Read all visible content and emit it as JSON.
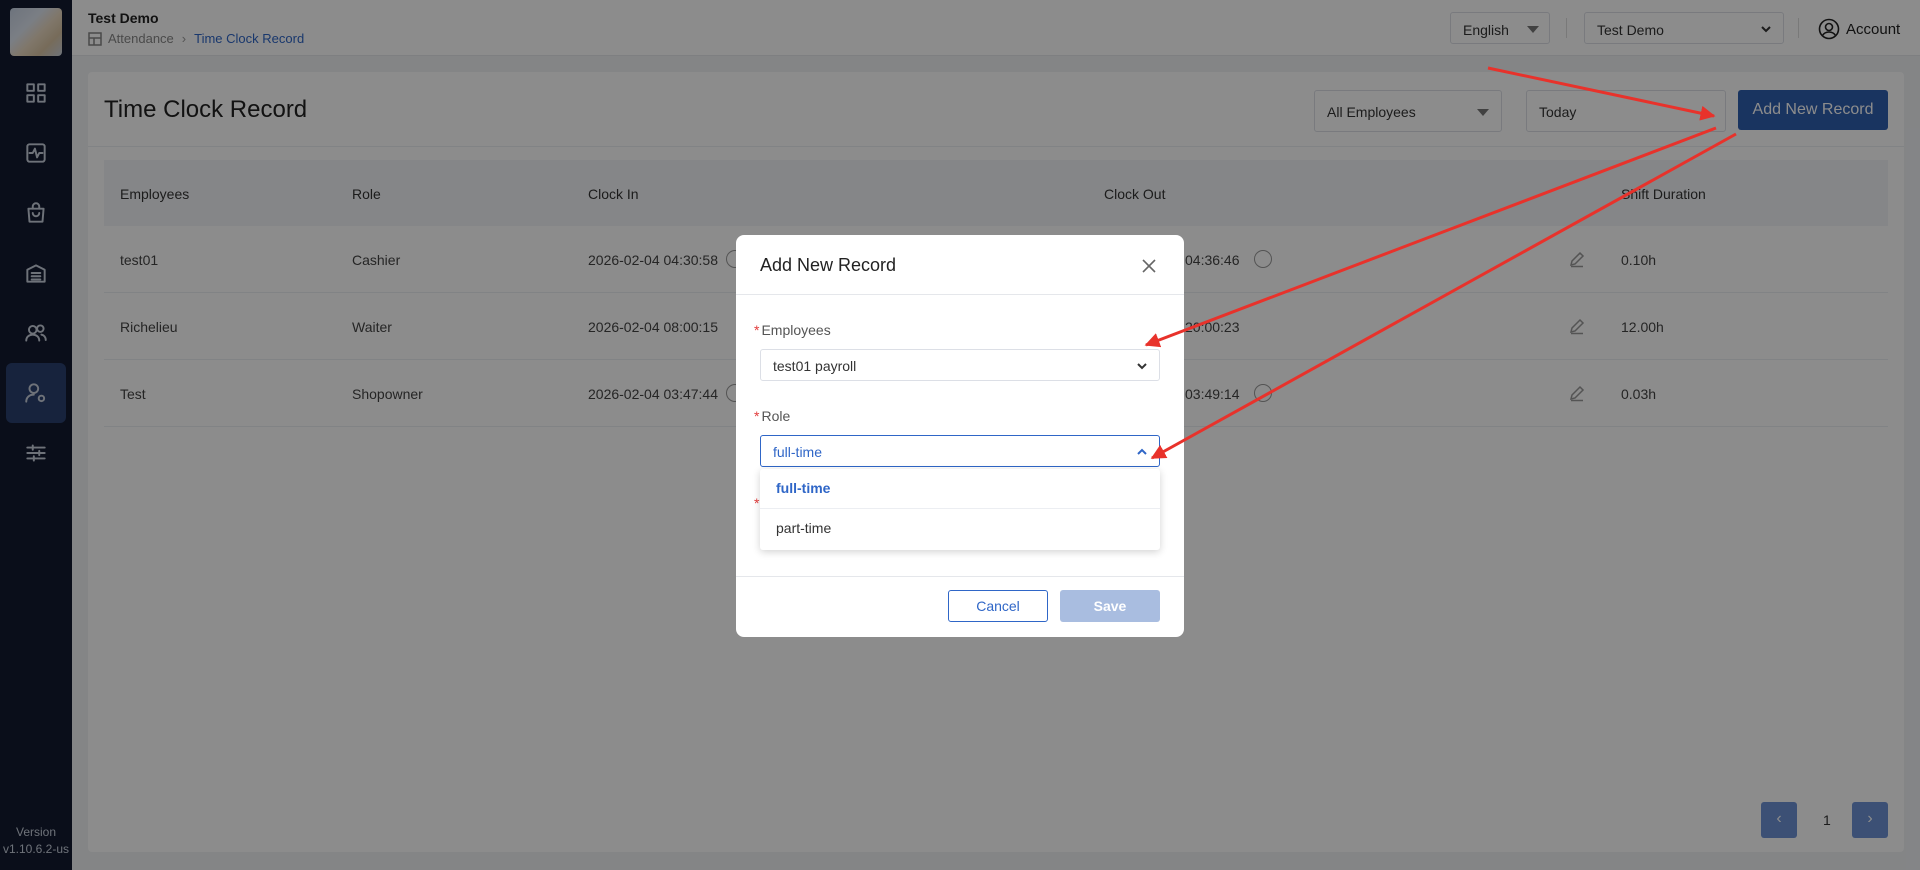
{
  "app": {
    "store_name": "Test Demo",
    "version_label": "Version",
    "version": "v1.10.6.2-us"
  },
  "breadcrumb": {
    "parent": "Attendance",
    "current": "Time Clock Record"
  },
  "header": {
    "language": "English",
    "store": "Test Demo",
    "account": "Account"
  },
  "page": {
    "title": "Time Clock Record",
    "filter_employees": "All Employees",
    "filter_date": "Today",
    "add_button": "Add New Record"
  },
  "table": {
    "columns": [
      "Employees",
      "Role",
      "Clock In",
      "Clock Out",
      "Shift Duration"
    ],
    "rows": [
      {
        "employee": "test01",
        "role": "Cashier",
        "clock_in": "2026-02-04 04:30:58",
        "clock_out": "04:36:46",
        "duration": "0.10h"
      },
      {
        "employee": "Richelieu",
        "role": "Waiter",
        "clock_in": "2026-02-04 08:00:15",
        "clock_out": "20:00:23",
        "duration": "12.00h"
      },
      {
        "employee": "Test",
        "role": "Shopowner",
        "clock_in": "2026-02-04 03:47:44",
        "clock_out": "03:49:14",
        "duration": "0.03h"
      }
    ]
  },
  "pagination": {
    "prev": "‹",
    "current": "1",
    "next": "›"
  },
  "modal": {
    "title": "Add New Record",
    "employees_label": "Employees",
    "employees_value": "test01 payroll",
    "role_label": "Role",
    "role_value": "full-time",
    "role_options": [
      "full-time",
      "part-time"
    ],
    "required_mark": "*",
    "cancel": "Cancel",
    "save": "Save"
  },
  "colors": {
    "accent": "#2f5fb0",
    "sidebar": "#131b30",
    "arrow": "#e8322b"
  }
}
